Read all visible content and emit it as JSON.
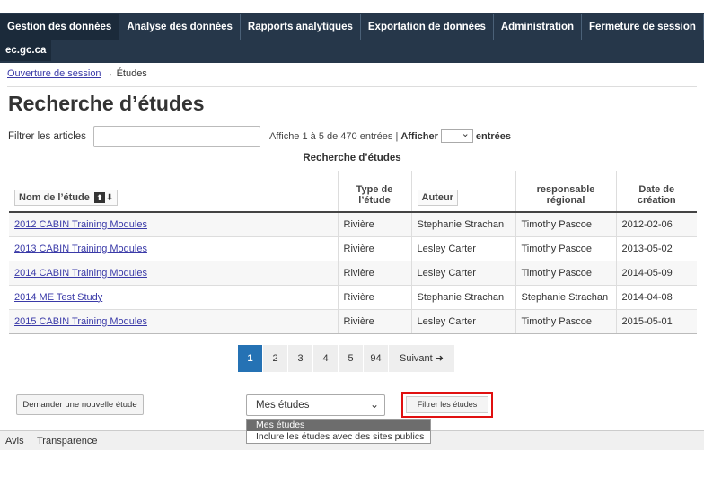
{
  "nav": {
    "items": [
      "Gestion des données",
      "Analyse des données",
      "Rapports analytiques",
      "Exportation de données",
      "Administration",
      "Fermeture de session"
    ],
    "site": "ec.gc.ca"
  },
  "breadcrumb": {
    "home": "Ouverture de session",
    "arrow": "→",
    "current": "Études"
  },
  "page": {
    "title": "Recherche d’études"
  },
  "filter": {
    "label": "Filtrer les articles",
    "value": "",
    "info_prefix": "Affiche 1 à 5 de 470 entrées |",
    "show_label": "Afficher",
    "show_suffix": "entrées"
  },
  "table": {
    "caption": "Recherche d’études",
    "headers": [
      "Nom de l’étude",
      "Type de l’étude",
      "Auteur",
      "responsable régional",
      "Date de création"
    ],
    "rows": [
      [
        "2012 CABIN Training Modules",
        "Rivière",
        "Stephanie Strachan",
        "Timothy Pascoe",
        "2012-02-06"
      ],
      [
        "2013 CABIN Training Modules",
        "Rivière",
        "Lesley Carter",
        "Timothy Pascoe",
        "2013-05-02"
      ],
      [
        "2014 CABIN Training Modules",
        "Rivière",
        "Lesley Carter",
        "Timothy Pascoe",
        "2014-05-09"
      ],
      [
        "2014 ME Test Study",
        "Rivière",
        "Stephanie Strachan",
        "Stephanie Strachan",
        "2014-04-08"
      ],
      [
        "2015 CABIN Training Modules",
        "Rivière",
        "Lesley Carter",
        "Timothy Pascoe",
        "2015-05-01"
      ]
    ]
  },
  "pagination": {
    "pages": [
      "1",
      "2",
      "3",
      "4",
      "5",
      "94"
    ],
    "current": "1",
    "next": "Suivant"
  },
  "actions": {
    "new_study": "Demander une nouvelle étude",
    "scope_selected": "Mes études",
    "filter_button": "Filtrer les études",
    "options": [
      "Mes études",
      "Inclure les études avec des sites publics"
    ]
  },
  "footer": {
    "links": [
      "Avis",
      "Transparence"
    ]
  },
  "colors": {
    "nav_bg": "#26374a",
    "accent": "#2572b4",
    "highlight": "#e01010"
  }
}
